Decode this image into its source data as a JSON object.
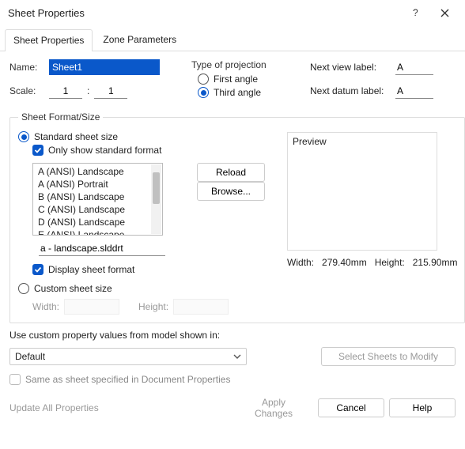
{
  "window": {
    "title": "Sheet Properties"
  },
  "tabs": {
    "active": "Sheet Properties",
    "t0": "Sheet Properties",
    "t1": "Zone Parameters"
  },
  "fields": {
    "name_label": "Name:",
    "name_value": "Sheet1",
    "scale_label": "Scale:",
    "scale_a": "1",
    "scale_b": "1",
    "scale_sep": ":"
  },
  "projection": {
    "group": "Type of projection",
    "first": "First angle",
    "third": "Third angle"
  },
  "labels": {
    "next_view": "Next view label:",
    "next_view_val": "A",
    "next_datum": "Next datum label:",
    "next_datum_val": "A"
  },
  "format": {
    "legend": "Sheet Format/Size",
    "standard": "Standard sheet size",
    "only_standard": "Only show standard format",
    "list": [
      "A (ANSI) Landscape",
      "A (ANSI) Portrait",
      "B (ANSI) Landscape",
      "C (ANSI) Landscape",
      "D (ANSI) Landscape",
      "E (ANSI) Landscape"
    ],
    "reload": "Reload",
    "file": "a - landscape.slddrt",
    "browse": "Browse...",
    "display": "Display sheet format",
    "custom": "Custom sheet size",
    "width_label": "Width:",
    "height_label": "Height:",
    "preview": "Preview",
    "w_label": "Width:",
    "w_val": "279.40mm",
    "h_label": "Height:",
    "h_val": "215.90mm"
  },
  "customprop": {
    "label": "Use custom property values from model shown in:",
    "value": "Default",
    "select_sheets": "Select Sheets to Modify",
    "same_as": "Same as sheet specified in Document Properties"
  },
  "footer": {
    "update": "Update All Properties",
    "apply": "Apply Changes",
    "cancel": "Cancel",
    "help": "Help"
  }
}
